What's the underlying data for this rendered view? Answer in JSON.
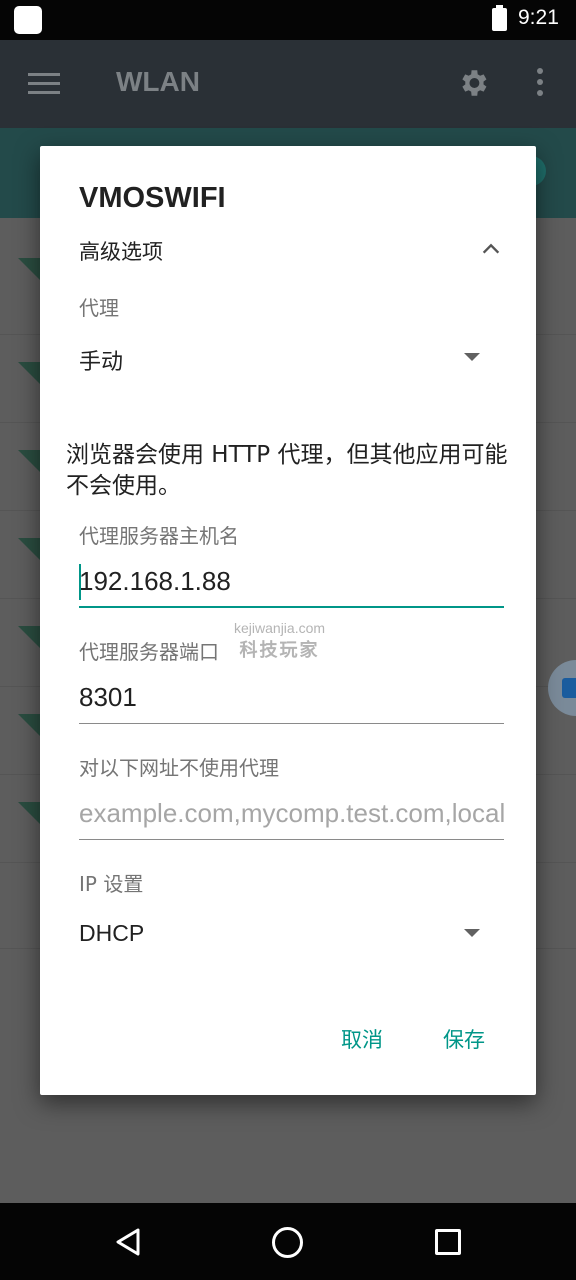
{
  "status_bar": {
    "time": "9:21"
  },
  "toolbar": {
    "title": "WLAN",
    "menu_icon": "hamburger-menu-icon",
    "settings_icon": "gear-icon",
    "overflow_icon": "more-vert-icon"
  },
  "dialog": {
    "title": "VMOSWIFI",
    "advanced_options_label": "高级选项",
    "proxy": {
      "caption": "代理",
      "selected": "手动"
    },
    "proxy_note": "浏览器会使用 HTTP 代理，但其他应用可能不会使用。",
    "proxy_host": {
      "caption": "代理服务器主机名",
      "value": "192.168.1.88"
    },
    "proxy_port": {
      "caption": "代理服务器端口",
      "value": "8301"
    },
    "bypass": {
      "caption": "对以下网址不使用代理",
      "placeholder": "example.com,mycomp.test.com,localhost"
    },
    "ip_settings": {
      "caption": "IP 设置",
      "selected": "DHCP"
    },
    "buttons": {
      "cancel": "取消",
      "save": "保存"
    }
  },
  "watermark": {
    "line1": "kejiwanjia.com",
    "line2": "科技玩家"
  },
  "colors": {
    "accent": "#009688",
    "toolbar": "#2a3036",
    "dialog_bg": "#ffffff"
  }
}
